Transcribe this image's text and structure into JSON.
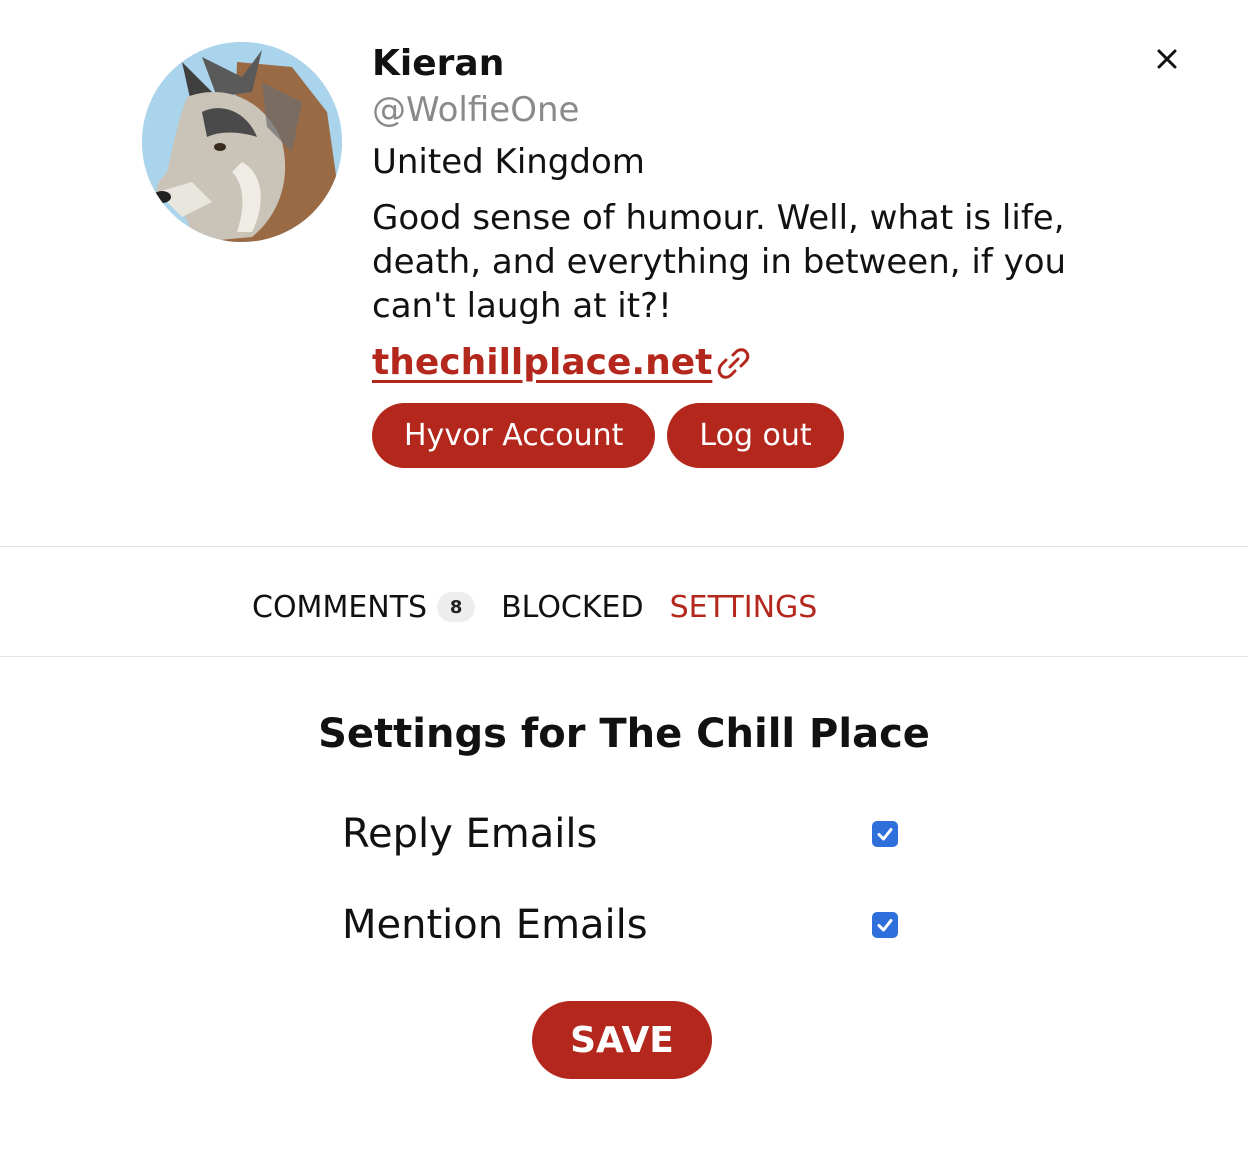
{
  "profile": {
    "name": "Kieran",
    "handle": "@WolfieOne",
    "location": "United Kingdom",
    "bio": "Good sense of humour. Well, what is life, death, and everything in between, if you can't laugh at it?!",
    "website": "thechillplace.net",
    "avatar_icon": "wolf-avatar",
    "buttons": {
      "account": "Hyvor Account",
      "logout": "Log out"
    }
  },
  "close_icon": "close-icon",
  "tabs": {
    "comments": {
      "label": "COMMENTS",
      "count": "8"
    },
    "blocked": {
      "label": "BLOCKED"
    },
    "settings": {
      "label": "SETTINGS",
      "active": true
    }
  },
  "settings": {
    "title": "Settings for The Chill Place",
    "options": [
      {
        "label": "Reply Emails",
        "checked": true
      },
      {
        "label": "Mention Emails",
        "checked": true
      }
    ],
    "save_label": "SAVE"
  },
  "colors": {
    "accent": "#b3271c",
    "checkbox": "#2f6fdc",
    "muted_text": "#8a8a8a"
  }
}
